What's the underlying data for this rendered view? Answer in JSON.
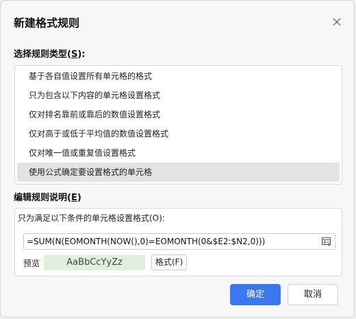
{
  "dialog": {
    "title": "新建格式规则",
    "close_icon": "close-icon"
  },
  "rule_type": {
    "label_prefix": "选择规则类型(",
    "label_key": "S",
    "label_suffix": "):",
    "items": [
      "基于各自值设置所有单元格的格式",
      "只为包含以下内容的单元格设置格式",
      "仅对排名靠前或靠后的数值设置格式",
      "仅对高于或低于平均值的数值设置格式",
      "仅对唯一值或重复值设置格式",
      "使用公式确定要设置格式的单元格"
    ],
    "selected_index": 5
  },
  "rule_desc": {
    "label_prefix": "编辑规则说明(",
    "label_key": "E",
    "label_suffix": ")",
    "condition_label": "只为满足以下条件的单元格设置格式(O):",
    "formula_value": "=SUM(N(EOMONTH(NOW(),0)=EOMONTH(0&$E2:$N2,0)))",
    "ref_icon": "range-select-icon",
    "preview_label": "预览",
    "preview_sample": "AaBbCcYyZz",
    "format_button": "格式(F)",
    "colors": {
      "preview_bg": "#e2efda"
    }
  },
  "footer": {
    "ok": "确定",
    "cancel": "取消",
    "colors": {
      "ok_bg": "#3b78f0"
    }
  }
}
